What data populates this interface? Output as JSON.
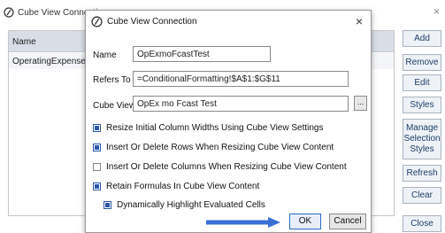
{
  "background": {
    "title": "Cube View Connections",
    "grid_header": "Name",
    "grid_row": "OperatingExpense1",
    "buttons": {
      "add": "Add",
      "remove": "Remove",
      "edit": "Edit",
      "styles": "Styles",
      "manage": "Manage Selection Styles",
      "refresh": "Refresh",
      "clear": "Clear",
      "close": "Close"
    }
  },
  "dialog": {
    "title": "Cube View Connection",
    "name_label": "Name",
    "name_value": "OpExmoFcastTest",
    "refers_label": "Refers To",
    "refers_value": "=ConditionalFormatting!$A$1:$G$11",
    "cubeview_label": "Cube View",
    "cubeview_value": "OpEx mo Fcast Test",
    "ellipsis": "...",
    "options": [
      {
        "label": "Resize Initial Column Widths Using Cube View Settings",
        "checked": true
      },
      {
        "label": "Insert Or Delete Rows When Resizing Cube View Content",
        "checked": true
      },
      {
        "label": "Insert Or Delete Columns When Resizing Cube View Content",
        "checked": false
      },
      {
        "label": "Retain Formulas In Cube View Content",
        "checked": true
      },
      {
        "label": "Dynamically Highlight Evaluated Cells",
        "checked": true
      }
    ],
    "ok": "OK",
    "cancel": "Cancel",
    "close_icon": "×"
  },
  "colors": {
    "accent": "#2b58a8",
    "arrow": "#3a6fd8"
  }
}
